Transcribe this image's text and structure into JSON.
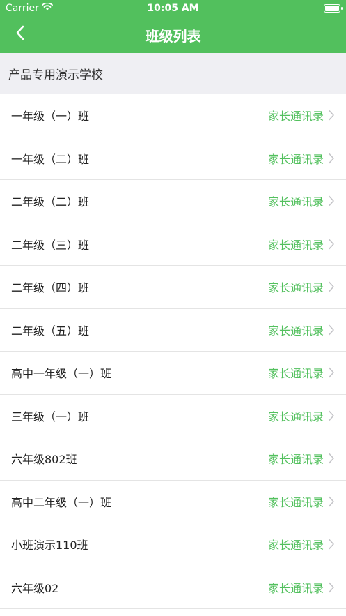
{
  "status": {
    "carrier": "Carrier",
    "time": "10:05 AM"
  },
  "nav": {
    "title": "班级列表"
  },
  "school": {
    "name": "产品专用演示学校"
  },
  "classes": [
    {
      "name": "一年级（一）班",
      "action": "家长通讯录"
    },
    {
      "name": "一年级（二）班",
      "action": "家长通讯录"
    },
    {
      "name": "二年级（二）班",
      "action": "家长通讯录"
    },
    {
      "name": "二年级（三）班",
      "action": "家长通讯录"
    },
    {
      "name": "二年级（四）班",
      "action": "家长通讯录"
    },
    {
      "name": "二年级（五）班",
      "action": "家长通讯录"
    },
    {
      "name": "高中一年级（一）班",
      "action": "家长通讯录"
    },
    {
      "name": "三年级（一）班",
      "action": "家长通讯录"
    },
    {
      "name": "六年级802班",
      "action": "家长通讯录"
    },
    {
      "name": "高中二年级（一）班",
      "action": "家长通讯录"
    },
    {
      "name": "小班演示110班",
      "action": "家长通讯录"
    },
    {
      "name": "六年级02",
      "action": "家长通讯录"
    }
  ],
  "colors": {
    "accent": "#52c05d"
  },
  "icons": {
    "back": "chevron-left-icon",
    "row_arrow": "chevron-right-icon",
    "wifi": "wifi-icon",
    "battery": "battery-icon"
  }
}
